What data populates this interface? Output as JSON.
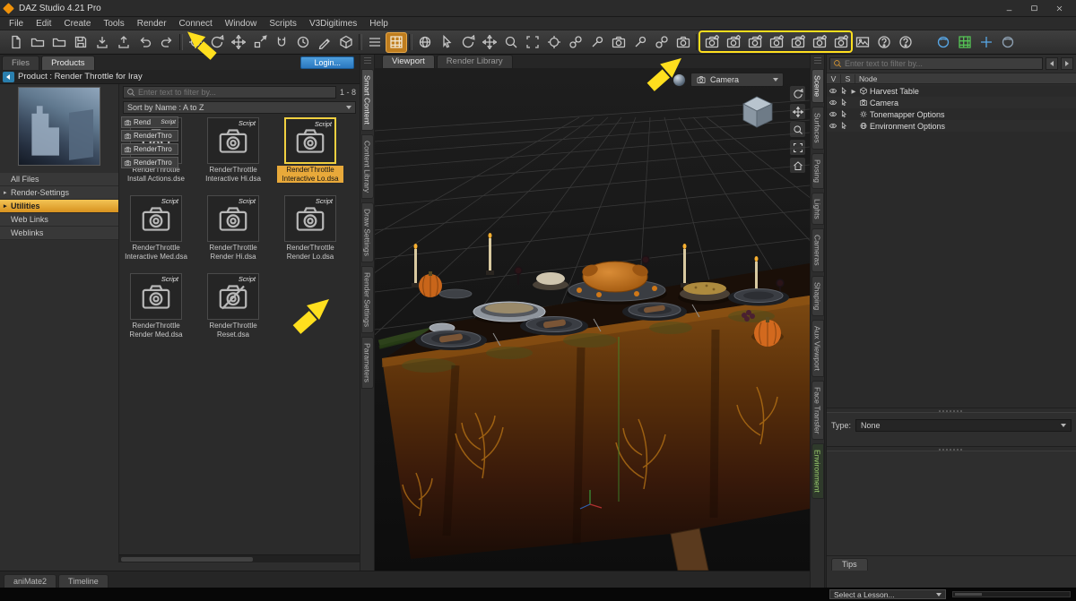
{
  "window": {
    "title": "DAZ Studio 4.21 Pro"
  },
  "menu": {
    "items": [
      {
        "name": "menu-file",
        "label": "File"
      },
      {
        "name": "menu-edit",
        "label": "Edit"
      },
      {
        "name": "menu-create",
        "label": "Create"
      },
      {
        "name": "menu-tools",
        "label": "Tools"
      },
      {
        "name": "menu-render",
        "label": "Render"
      },
      {
        "name": "menu-connect",
        "label": "Connect"
      },
      {
        "name": "menu-window",
        "label": "Window"
      },
      {
        "name": "menu-scripts",
        "label": "Scripts"
      },
      {
        "name": "menu-v3digitimes",
        "label": "V3Digitimes"
      },
      {
        "name": "menu-help",
        "label": "Help"
      }
    ]
  },
  "toolbar": {
    "icons": [
      {
        "name": "new-scene-button",
        "icon": "i-doc"
      },
      {
        "name": "open-scene-button",
        "icon": "i-folder"
      },
      {
        "name": "merge-scene-button",
        "icon": "i-folder"
      },
      {
        "name": "save-scene-button",
        "icon": "i-save"
      },
      {
        "name": "import-button",
        "icon": "i-import"
      },
      {
        "name": "export-button",
        "icon": "i-export"
      },
      {
        "name": "undo-button",
        "icon": "i-undo"
      },
      {
        "name": "redo-button",
        "icon": "i-redo"
      },
      {
        "cls": "sep"
      },
      {
        "name": "scene-navigator-tool",
        "icon": "i-target"
      },
      {
        "name": "rotate-tool",
        "icon": "i-rotate"
      },
      {
        "name": "translate-tool",
        "icon": "i-move"
      },
      {
        "name": "scale-tool",
        "icon": "i-scale"
      },
      {
        "name": "snap-tool",
        "icon": "i-magnet"
      },
      {
        "name": "timeline-tool",
        "icon": "i-clock"
      },
      {
        "name": "surface-selection-tool",
        "icon": "i-pen"
      },
      {
        "name": "geometry-editor-tool",
        "icon": "i-cube"
      },
      {
        "cls": "sep"
      },
      {
        "name": "list-view-button",
        "icon": "i-lines"
      },
      {
        "name": "draw-style-button",
        "icon": "i-grid",
        "cls": "active"
      },
      {
        "cls": "sep"
      },
      {
        "name": "iray-preview-button",
        "icon": "i-globe"
      },
      {
        "name": "node-selection-tool",
        "icon": "i-cursor"
      },
      {
        "name": "orbit-view-tool",
        "icon": "i-rotate"
      },
      {
        "name": "pan-view-tool",
        "icon": "i-move"
      },
      {
        "name": "dolly-view-tool",
        "icon": "i-zoom"
      },
      {
        "name": "frame-view-tool",
        "icon": "i-frame"
      },
      {
        "name": "aim-view-tool",
        "icon": "i-target"
      },
      {
        "name": "link-tool",
        "icon": "i-link"
      },
      {
        "name": "pin-translation-button",
        "icon": "i-pin"
      },
      {
        "name": "camera-view-button",
        "icon": "i-cam"
      },
      {
        "name": "pin-rotation-button",
        "icon": "i-pin"
      },
      {
        "name": "link-selection-button",
        "icon": "i-link"
      },
      {
        "name": "camera-settings-button",
        "icon": "i-cam"
      },
      {
        "cls": "sep"
      },
      {
        "name": "render-throttle-install-button",
        "icon": "i-cam-gear"
      },
      {
        "name": "render-throttle-interactive-hi-button",
        "icon": "i-cam-gear"
      },
      {
        "name": "render-throttle-interactive-lo-button",
        "icon": "i-cam-gear"
      },
      {
        "name": "render-throttle-interactive-med-button",
        "icon": "i-cam-gear"
      },
      {
        "name": "render-throttle-render-hi-button",
        "icon": "i-cam-gear"
      },
      {
        "name": "render-throttle-render-lo-button",
        "icon": "i-cam-gear"
      },
      {
        "name": "render-throttle-render-med-button",
        "icon": "i-cam-gear"
      },
      {
        "name": "render-button",
        "icon": "i-render"
      },
      {
        "name": "help-button",
        "icon": "i-help"
      },
      {
        "name": "whats-this-button",
        "icon": "i-help"
      },
      {
        "name": "connect-status-icon",
        "icon": "i-sphere",
        "cls": "push c-blue"
      },
      {
        "name": "cms-status-icon",
        "icon": "i-grid",
        "cls": "c-green"
      },
      {
        "name": "add-content-button",
        "icon": "i-plus",
        "cls": "c-blue"
      },
      {
        "name": "iray-status-icon",
        "icon": "i-sphere",
        "cls": "c-dark"
      }
    ]
  },
  "left_panel": {
    "tabs": [
      {
        "name": "tab-files",
        "label": "Files"
      },
      {
        "name": "tab-products",
        "label": "Products",
        "cls": "active"
      }
    ],
    "login_label": "Login...",
    "breadcrumb": "Product : Render Throttle for Iray",
    "categories": [
      {
        "name": "category-all-files",
        "label": "All Files"
      },
      {
        "name": "category-render-settings",
        "label": "Render-Settings",
        "exp": "▸"
      },
      {
        "name": "category-utilities",
        "label": "Utilities",
        "exp": "▸",
        "cls": "highlight"
      },
      {
        "name": "category-web-links",
        "label": "Web Links"
      },
      {
        "name": "category-weblinks",
        "label": "Weblinks"
      }
    ],
    "search": {
      "placeholder": "Enter text to filter by...",
      "count": "1 - 8"
    },
    "sort_label": "Sort by Name : A to Z",
    "mini_items": [
      {
        "label": "Rend",
        "badge": "Script"
      },
      {
        "label": "RenderThro"
      },
      {
        "label": "RenderThro"
      },
      {
        "label": "RenderThro"
      }
    ],
    "files": [
      {
        "name": "file-renderthrottle-install-actions",
        "label": "RenderThrottle Install Actions.dse",
        "badge": "Script",
        "icon": "i-cam-big"
      },
      {
        "name": "file-renderthrottle-interactive-hi",
        "label": "RenderThrottle Interactive Hi.dsa",
        "badge": "Script",
        "icon": "i-cam-big"
      },
      {
        "name": "file-renderthrottle-interactive-lo",
        "label": "RenderThrottle Interactive Lo.dsa",
        "badge": "Script",
        "icon": "i-cam-big",
        "cls": "selected"
      },
      {
        "name": "file-renderthrottle-interactive-med",
        "label": "RenderThrottle Interactive Med.dsa",
        "badge": "Script",
        "icon": "i-cam-big"
      },
      {
        "name": "file-renderthrottle-render-hi",
        "label": "RenderThrottle Render Hi.dsa",
        "badge": "Script",
        "icon": "i-cam-big"
      },
      {
        "name": "file-renderthrottle-render-lo",
        "label": "RenderThrottle Render Lo.dsa",
        "badge": "Script",
        "icon": "i-cam-big"
      },
      {
        "name": "file-renderthrottle-render-med",
        "label": "RenderThrottle Render Med.dsa",
        "badge": "Script",
        "icon": "i-cam-big"
      },
      {
        "name": "file-renderthrottle-reset",
        "label": "RenderThrottle Reset.dsa",
        "badge": "Script",
        "icon": "i-cam-reset"
      }
    ]
  },
  "left_tabs": {
    "items": [
      {
        "name": "tab-smart-content",
        "label": "Smart Content",
        "cls": "active"
      },
      {
        "name": "tab-content-library",
        "label": "Content Library"
      },
      {
        "name": "tab-draw-settings",
        "label": "Draw Settings"
      },
      {
        "name": "tab-render-settings",
        "label": "Render Settings"
      },
      {
        "name": "tab-parameters",
        "label": "Parameters"
      }
    ]
  },
  "viewport": {
    "tabs": [
      {
        "name": "tab-viewport",
        "label": "Viewport",
        "cls": "active"
      },
      {
        "name": "tab-render-library",
        "label": "Render Library"
      }
    ],
    "camera_label": "Camera"
  },
  "right_tabs": {
    "items": [
      {
        "name": "tab-scene",
        "label": "Scene",
        "cls": "active"
      },
      {
        "name": "tab-surfaces",
        "label": "Surfaces"
      },
      {
        "name": "tab-posing",
        "label": "Posing"
      },
      {
        "name": "tab-lights",
        "label": "Lights"
      },
      {
        "name": "tab-cameras",
        "label": "Cameras"
      },
      {
        "name": "tab-shaping",
        "label": "Shaping"
      },
      {
        "name": "tab-aux-viewport",
        "label": "Aux Viewport"
      },
      {
        "name": "tab-face-transfer",
        "label": "Face Transfer"
      },
      {
        "name": "tab-environment",
        "label": "Environment",
        "cls": "green"
      }
    ]
  },
  "right_panel": {
    "filter_placeholder": "Enter text to filter by...",
    "header": {
      "v": "V",
      "s": "S",
      "node": "Node"
    },
    "nodes": [
      {
        "name": "node-harvest-table",
        "label": "Harvest Table",
        "exp": "▶",
        "icon": "i-cube"
      },
      {
        "name": "node-camera",
        "label": "Camera",
        "icon": "i-cam"
      },
      {
        "name": "node-tonemapper-options",
        "label": "Tonemapper Options",
        "icon": "i-gear"
      },
      {
        "name": "node-environment-options",
        "label": "Environment Options",
        "icon": "i-globe"
      }
    ],
    "type_label": "Type:",
    "type_value": "None",
    "tips_label": "Tips"
  },
  "bottom": {
    "tabs": [
      {
        "name": "tab-animate2",
        "label": "aniMate2"
      },
      {
        "name": "tab-timeline",
        "label": "Timeline"
      }
    ]
  },
  "status": {
    "lesson_label": "Select a Lesson..."
  },
  "colors": {
    "annotation": "#ffdf1e",
    "accent": "#e8a93a",
    "login": "#2d7fc1"
  }
}
